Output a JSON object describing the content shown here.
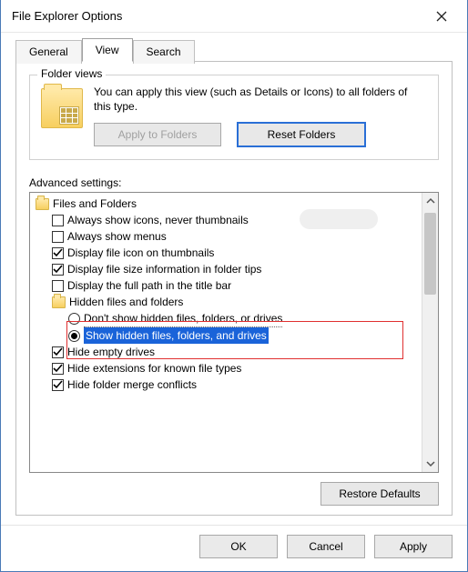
{
  "window": {
    "title": "File Explorer Options"
  },
  "tabs": {
    "general": "General",
    "view": "View",
    "search": "Search",
    "active": "view"
  },
  "folderViews": {
    "groupTitle": "Folder views",
    "description": "You can apply this view (such as Details or Icons) to all folders of this type.",
    "applyBtn": "Apply to Folders",
    "resetBtn": "Reset Folders"
  },
  "advanced": {
    "label": "Advanced settings:",
    "root": "Files and Folders",
    "items": [
      {
        "type": "checkbox",
        "checked": false,
        "label": "Always show icons, never thumbnails"
      },
      {
        "type": "checkbox",
        "checked": false,
        "label": "Always show menus"
      },
      {
        "type": "checkbox",
        "checked": true,
        "label": "Display file icon on thumbnails"
      },
      {
        "type": "checkbox",
        "checked": true,
        "label": "Display file size information in folder tips"
      },
      {
        "type": "checkbox",
        "checked": false,
        "label": "Display the full path in the title bar"
      },
      {
        "type": "folder",
        "label": "Hidden files and folders",
        "children": [
          {
            "type": "radio",
            "selected": false,
            "label": "Don't show hidden files, folders, or drives"
          },
          {
            "type": "radio",
            "selected": true,
            "label": "Show hidden files, folders, and drives"
          }
        ]
      },
      {
        "type": "checkbox",
        "checked": true,
        "label": "Hide empty drives"
      },
      {
        "type": "checkbox",
        "checked": true,
        "label": "Hide extensions for known file types"
      },
      {
        "type": "checkbox",
        "checked": true,
        "label": "Hide folder merge conflicts"
      }
    ]
  },
  "restoreBtn": "Restore Defaults",
  "dialogButtons": {
    "ok": "OK",
    "cancel": "Cancel",
    "apply": "Apply"
  }
}
